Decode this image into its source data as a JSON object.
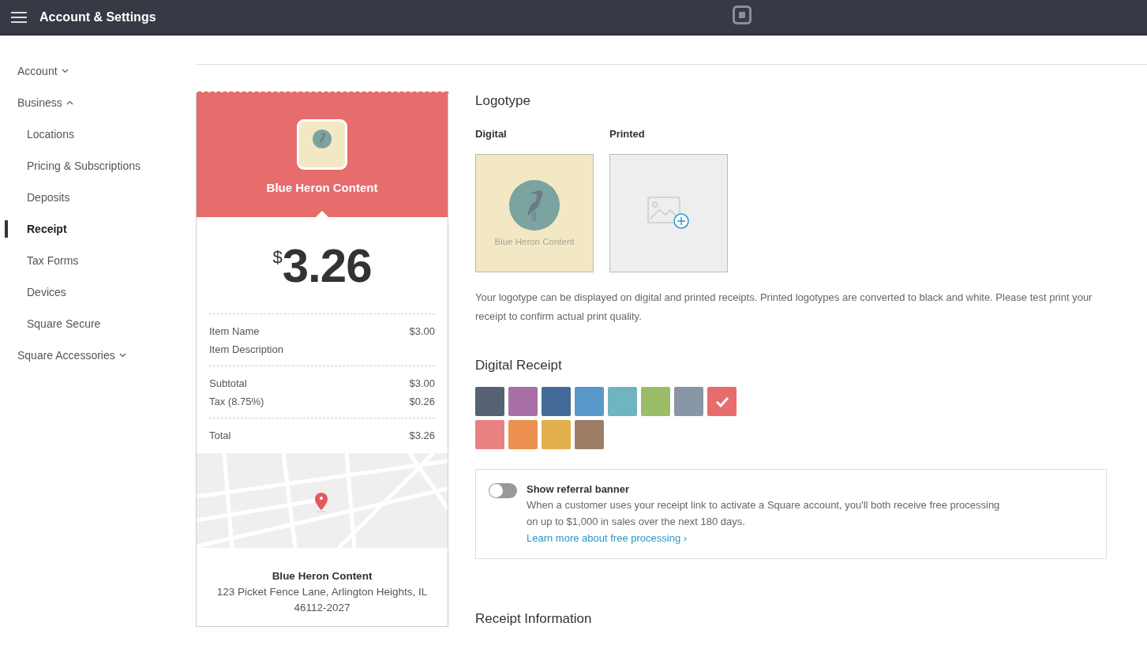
{
  "topbar": {
    "title": "Account & Settings"
  },
  "sidebar": {
    "items": [
      {
        "label": "Account",
        "expanded": false,
        "selected": false
      },
      {
        "label": "Business",
        "expanded": true,
        "selected": false,
        "children": [
          {
            "label": "Locations",
            "selected": false
          },
          {
            "label": "Pricing & Subscriptions",
            "selected": false
          },
          {
            "label": "Deposits",
            "selected": false
          },
          {
            "label": "Receipt",
            "selected": true
          },
          {
            "label": "Tax Forms",
            "selected": false
          },
          {
            "label": "Devices",
            "selected": false
          },
          {
            "label": "Square Secure",
            "selected": false
          }
        ]
      },
      {
        "label": "Square Accessories",
        "expanded": false,
        "selected": false
      }
    ]
  },
  "receipt": {
    "color": "#e76c6c",
    "business_name": "Blue Heron Content",
    "currency": "$",
    "amount": "3.26",
    "sections": [
      [
        {
          "label": "Item Name",
          "amount": "$3.00"
        },
        {
          "label": "Item Description"
        }
      ],
      [
        {
          "label": "Subtotal",
          "amount": "$3.00"
        },
        {
          "label": "Tax (8.75%)",
          "amount": "$0.26"
        }
      ],
      [
        {
          "label": "Total",
          "amount": "$3.26"
        }
      ]
    ],
    "map": {
      "kind": "picture"
    },
    "footer_name": "Blue Heron Content",
    "address_lines": [
      "123 Picket Fence Lane, Arlington Heights, IL",
      "46112-2027"
    ]
  },
  "logotype": {
    "title": "Logotype",
    "digital_label": "Digital",
    "printed_label": "Printed",
    "logo_text": "Blue Heron Content",
    "description": "Your logotype can be displayed on digital and printed receipts. Printed logotypes are converted to black and white. Please test print your receipt to confirm actual print quality."
  },
  "digital_receipt": {
    "title": "Digital Receipt",
    "swatches": [
      {
        "color": "#566173",
        "selected": false
      },
      {
        "color": "#a86fa8",
        "selected": false
      },
      {
        "color": "#436a99",
        "selected": false
      },
      {
        "color": "#5898c8",
        "selected": false
      },
      {
        "color": "#6fb4bf",
        "selected": false
      },
      {
        "color": "#9cbd68",
        "selected": false
      },
      {
        "color": "#8896a6",
        "selected": false
      },
      {
        "color": "#e76c6c",
        "selected": true
      },
      {
        "color": "#e88282",
        "selected": false
      },
      {
        "color": "#ec9150",
        "selected": false
      },
      {
        "color": "#e3b04b",
        "selected": false
      },
      {
        "color": "#9e7d66",
        "selected": false
      }
    ]
  },
  "referral": {
    "on": false,
    "title": "Show referral banner",
    "text": "When a customer uses your receipt link to activate a Square account, you'll both receive free processing on up to $1,000 in sales over the next 180 days.",
    "link": "Learn more about free processing ›"
  },
  "receipt_information": {
    "title": "Receipt Information"
  }
}
